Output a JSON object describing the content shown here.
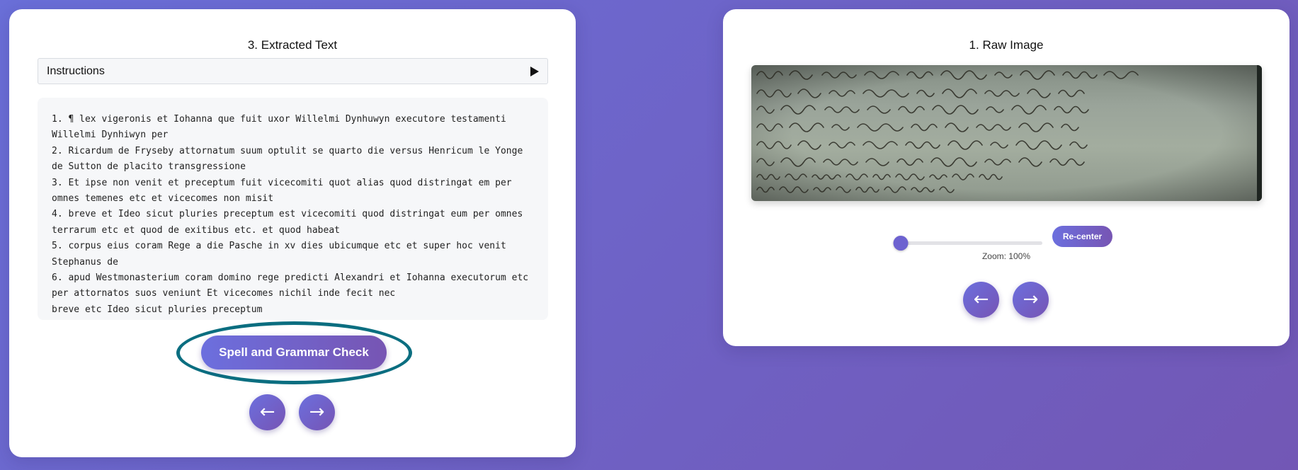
{
  "extracted_panel": {
    "title": "3. Extracted Text",
    "instructions_label": "Instructions",
    "lines": [
      " 1. ¶ lex vigeronis et Iohanna que fuit uxor Willelmi Dynhuwyn executore testamenti Willelmi Dynhiwyn per",
      " 2. Ricardum de Fryseby attornatum suum optulit se quarto die versus Henricum le Yonge de Sutton de placito transgressione",
      " 3. Et ipse non venit et preceptum fuit vicecomiti quot alias quod distringat em per omnes temenes etc et vicecomes non misit",
      " 4. breve et Ideo sicut pluries preceptum est vicecomiti quod distringat eum per omnes terrarum etc et quod de exitibus etc. et quod habeat",
      " 5. corpus eius coram Rege a die Pasche in xv dies ubicumque etc et super hoc venit Stephanus de",
      " 6. apud Westmonasterium coram domino rege predicti Alexandri et Iohanna executorum etc per attornatos suos veniunt Et vicecomes nichil inde fecit nec",
      "breve etc Ideo sicut pluries preceptum"
    ],
    "spell_check_label": "Spell and Grammar Check",
    "prev_label": "←",
    "next_label": "→"
  },
  "raw_panel": {
    "title": "1. Raw Image",
    "zoom": {
      "value": 0,
      "label": "Zoom: 100%"
    },
    "recenter_label": "Re-center",
    "prev_label": "←",
    "next_label": "→"
  },
  "colors": {
    "accent_start": "#6c6fde",
    "accent_end": "#7755b3",
    "highlight_ring": "#0b6e80"
  }
}
